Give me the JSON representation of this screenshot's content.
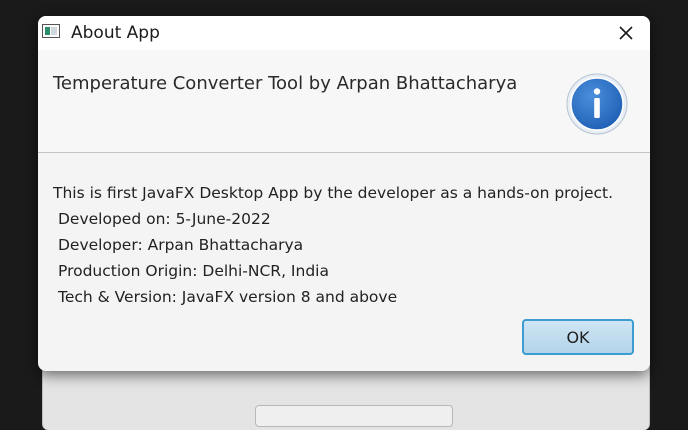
{
  "window": {
    "title": "About App"
  },
  "dialog": {
    "header_text": "Temperature Converter Tool by Arpan Bhattacharya",
    "header_icon": "info-icon",
    "content_lines": [
      "This is first JavaFX Desktop App by the developer as a hands-on project.",
      "Developed on: 5-June-2022",
      "Developer: Arpan Bhattacharya",
      "Production Origin: Delhi-NCR, India",
      "Tech & Version: JavaFX version 8 and above"
    ],
    "ok_label": "OK"
  },
  "colors": {
    "accent": "#3d9dd0",
    "info_icon_fill": "#2f73c5",
    "ok_button_fill": "#c2dcee"
  }
}
